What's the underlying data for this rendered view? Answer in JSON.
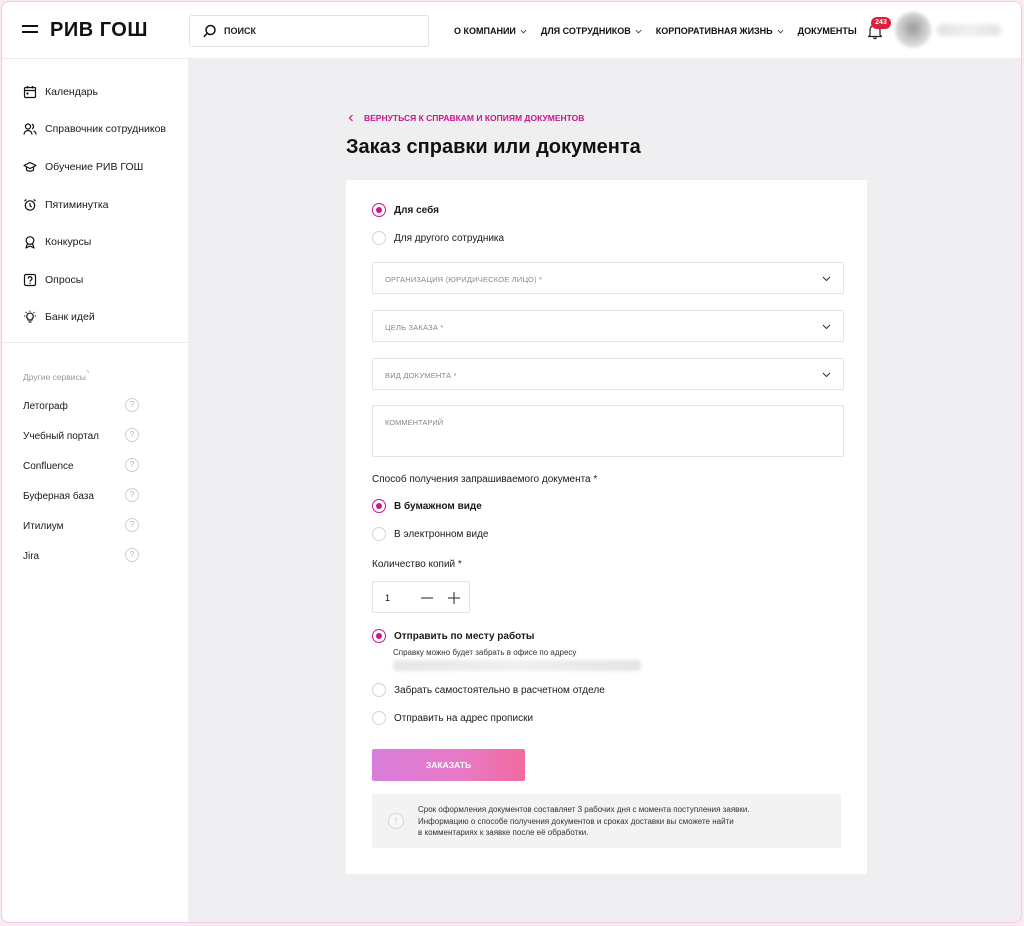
{
  "header": {
    "logo": "РИВ ГОШ",
    "search_placeholder": "ПОИСК",
    "nav": [
      {
        "label": "О КОМПАНИИ",
        "has_dropdown": true
      },
      {
        "label": "ДЛЯ СОТРУДНИКОВ",
        "has_dropdown": true
      },
      {
        "label": "КОРПОРАТИВНАЯ ЖИЗНЬ",
        "has_dropdown": true
      },
      {
        "label": "ДОКУМЕНТЫ",
        "has_dropdown": false
      }
    ],
    "notifications_count": "243"
  },
  "sidebar": {
    "items": [
      {
        "label": "Календарь",
        "icon": "calendar-icon"
      },
      {
        "label": "Справочник сотрудников",
        "icon": "people-icon"
      },
      {
        "label": "Обучение РИВ ГОШ",
        "icon": "graduation-cap-icon"
      },
      {
        "label": "Пятиминутка",
        "icon": "alarm-clock-icon"
      },
      {
        "label": "Конкурсы",
        "icon": "award-icon"
      },
      {
        "label": "Опросы",
        "icon": "question-square-icon"
      },
      {
        "label": "Банк идей",
        "icon": "lightbulb-icon"
      }
    ],
    "other_title": "Другие сервисы",
    "other_items": [
      {
        "label": "Летограф"
      },
      {
        "label": "Учебный портал"
      },
      {
        "label": "Confluence"
      },
      {
        "label": "Буферная база"
      },
      {
        "label": "Итилиум"
      },
      {
        "label": "Jira"
      }
    ]
  },
  "main": {
    "back_link": "ВЕРНУТЬСЯ К СПРАВКАМ И КОПИЯМ ДОКУМЕНТОВ",
    "title": "Заказ справки или документа",
    "for_whom": {
      "options": [
        "Для себя",
        "Для другого сотрудника"
      ],
      "selected": 0
    },
    "organization_placeholder": "ОРГАНИЗАЦИЯ (ЮРИДИЧЕСКОЕ ЛИЦО) *",
    "purpose_placeholder": "ЦЕЛЬ ЗАКАЗА *",
    "doc_type_placeholder": "ВИД ДОКУМЕНТА *",
    "comment_placeholder": "КОММЕНТАРИЙ",
    "receive_method_label": "Способ получения запрашиваемого документа *",
    "receive_options": [
      "В бумажном виде",
      "В электронном виде"
    ],
    "receive_selected": 0,
    "copies_label": "Количество копий *",
    "copies_value": "1",
    "delivery_options": [
      "Отправить по месту работы",
      "Забрать самостоятельно в расчетном отделе",
      "Отправить на адрес прописки"
    ],
    "delivery_selected": 0,
    "delivery_hint": "Справку можно будет забрать в офисе по адресу",
    "order_button": "ЗАКАЗАТЬ",
    "info_lines": [
      "Срок оформления документов составляет 3 рабочих дня с момента поступления заявки.",
      "Информацию о способе получения документов и сроках доставки вы сможете найти",
      "в комментариях к заявке после её обработки."
    ]
  },
  "colors": {
    "accent": "#c7168f",
    "badge": "#e21d3c",
    "button_gradient_start": "#d97edc",
    "button_gradient_end": "#f26a9f"
  }
}
